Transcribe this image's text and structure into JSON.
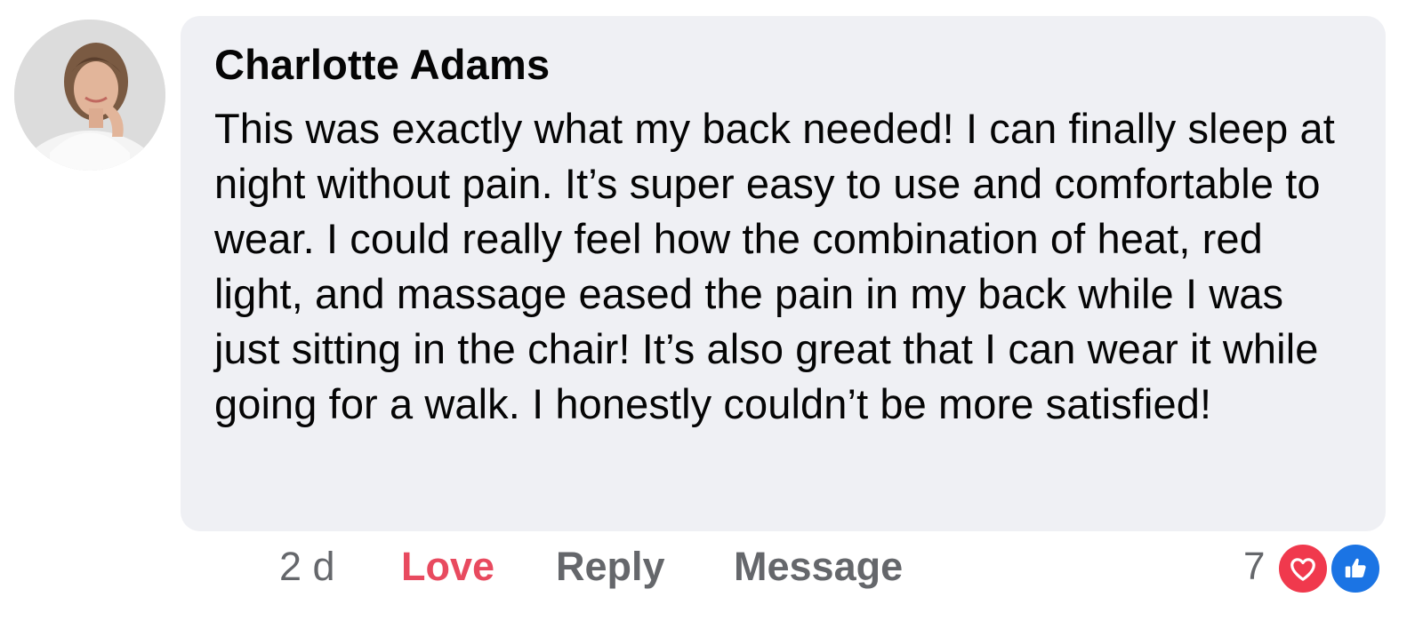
{
  "comment": {
    "author": "Charlotte Adams",
    "text": "This was exactly what my back needed! I can finally sleep at night without pain. It’s super easy to use and comfortable to wear. I could really feel how the combination of heat, red light, and massage eased the pain in my back while I was just sitting in the chair! It’s also great that I can wear it while going for a walk. I honestly couldn’t be more satisfied!",
    "avatar_icon": "user-avatar-photo",
    "bubble_color": "#eff0f4"
  },
  "actions": {
    "time": "2 d",
    "love_label": "Love",
    "reply_label": "Reply",
    "message_label": "Message",
    "love_color": "#e84a5f"
  },
  "reactions": {
    "count": "7",
    "icons": [
      "heart-icon",
      "thumbs-up-icon"
    ],
    "heart_color": "#f0394d",
    "like_color": "#1b74e4"
  }
}
